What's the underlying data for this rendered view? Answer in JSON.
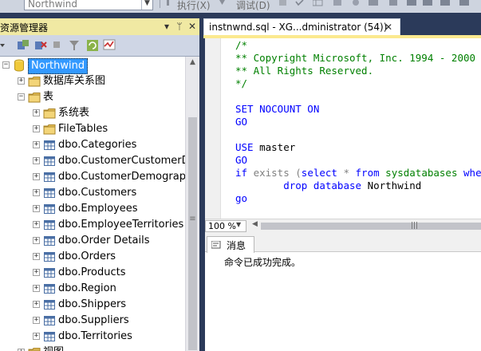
{
  "toolbar": {
    "database": "Northwind",
    "execute_label": "执行(X)",
    "debug_label": "调试(D)"
  },
  "object_explorer": {
    "title": "资源管理器",
    "pin": "▾ ᛘ",
    "close": "✕",
    "tree": [
      {
        "level": 0,
        "label": "Northwind",
        "expander": "−",
        "icon": "database-icon",
        "selected": true
      },
      {
        "level": 1,
        "label": "数据库关系图",
        "expander": "+",
        "icon": "folder-icon"
      },
      {
        "level": 1,
        "label": "表",
        "expander": "−",
        "icon": "folder-icon"
      },
      {
        "level": 2,
        "label": "系统表",
        "expander": "+",
        "icon": "folder-icon"
      },
      {
        "level": 2,
        "label": "FileTables",
        "expander": "+",
        "icon": "folder-icon"
      },
      {
        "level": 2,
        "label": "dbo.Categories",
        "expander": "+",
        "icon": "table-icon"
      },
      {
        "level": 2,
        "label": "dbo.CustomerCustomerDe",
        "expander": "+",
        "icon": "table-icon"
      },
      {
        "level": 2,
        "label": "dbo.CustomerDemographi",
        "expander": "+",
        "icon": "table-icon"
      },
      {
        "level": 2,
        "label": "dbo.Customers",
        "expander": "+",
        "icon": "table-icon"
      },
      {
        "level": 2,
        "label": "dbo.Employees",
        "expander": "+",
        "icon": "table-icon"
      },
      {
        "level": 2,
        "label": "dbo.EmployeeTerritories",
        "expander": "+",
        "icon": "table-icon"
      },
      {
        "level": 2,
        "label": "dbo.Order Details",
        "expander": "+",
        "icon": "table-icon"
      },
      {
        "level": 2,
        "label": "dbo.Orders",
        "expander": "+",
        "icon": "table-icon"
      },
      {
        "level": 2,
        "label": "dbo.Products",
        "expander": "+",
        "icon": "table-icon"
      },
      {
        "level": 2,
        "label": "dbo.Region",
        "expander": "+",
        "icon": "table-icon"
      },
      {
        "level": 2,
        "label": "dbo.Shippers",
        "expander": "+",
        "icon": "table-icon"
      },
      {
        "level": 2,
        "label": "dbo.Suppliers",
        "expander": "+",
        "icon": "table-icon"
      },
      {
        "level": 2,
        "label": "dbo.Territories",
        "expander": "+",
        "icon": "table-icon"
      },
      {
        "level": 1,
        "label": "视图",
        "expander": "+",
        "icon": "folder-icon"
      }
    ]
  },
  "editor": {
    "tab_title": "instnwnd.sql - XG...dministrator (54))",
    "tab_close": "✕",
    "code": [
      [
        {
          "t": "/*",
          "c": "c-comment"
        }
      ],
      [
        {
          "t": "** Copyright Microsoft, Inc. 1994 - 2000",
          "c": "c-comment"
        }
      ],
      [
        {
          "t": "** All Rights Reserved.",
          "c": "c-comment"
        }
      ],
      [
        {
          "t": "*/",
          "c": "c-comment"
        }
      ],
      [],
      [
        {
          "t": "SET NOCOUNT ON",
          "c": "c-kw"
        }
      ],
      [
        {
          "t": "GO",
          "c": "c-kw"
        }
      ],
      [],
      [
        {
          "t": "USE ",
          "c": "c-kw"
        },
        {
          "t": "master",
          "c": "c-text"
        }
      ],
      [
        {
          "t": "GO",
          "c": "c-kw"
        }
      ],
      [
        {
          "t": "if ",
          "c": "c-kw"
        },
        {
          "t": "exists (",
          "c": "c-gray"
        },
        {
          "t": "select",
          "c": "c-kw"
        },
        {
          "t": " * ",
          "c": "c-gray"
        },
        {
          "t": "from ",
          "c": "c-kw"
        },
        {
          "t": "sysdatabases ",
          "c": "c-sys"
        },
        {
          "t": "where",
          "c": "c-kw"
        }
      ],
      [
        {
          "t": "        drop database ",
          "c": "c-kw"
        },
        {
          "t": "Northwind",
          "c": "c-text"
        }
      ],
      [
        {
          "t": "go",
          "c": "c-kw"
        }
      ]
    ],
    "zoom": "100 %"
  },
  "results": {
    "tab_label": "消息",
    "message": "命令已成功完成。"
  }
}
